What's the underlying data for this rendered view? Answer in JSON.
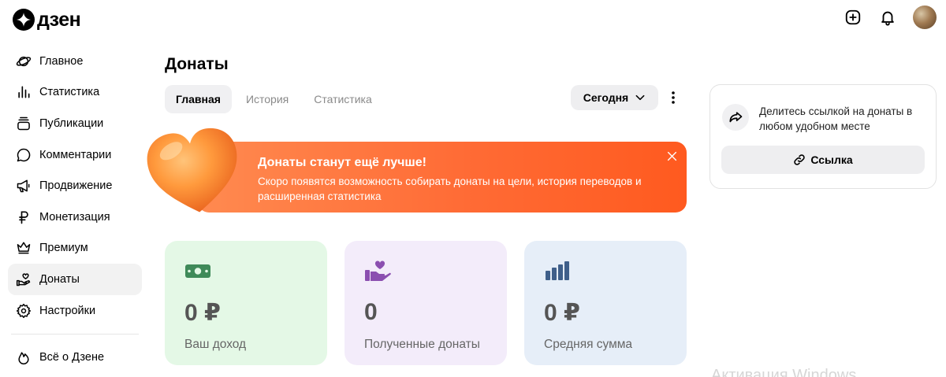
{
  "brand": {
    "name": "дзен",
    "logo_icon": "zen-star-icon"
  },
  "topbar": {
    "icons": [
      "add-icon",
      "bell-icon"
    ],
    "avatar": "avatar"
  },
  "sidebar": {
    "items": [
      {
        "label": "Главное",
        "icon": "planet-icon"
      },
      {
        "label": "Статистика",
        "icon": "bars-icon"
      },
      {
        "label": "Публикации",
        "icon": "stack-icon"
      },
      {
        "label": "Комментарии",
        "icon": "comment-icon"
      },
      {
        "label": "Продвижение",
        "icon": "megaphone-icon"
      },
      {
        "label": "Монетизация",
        "icon": "ruble-icon"
      },
      {
        "label": "Премиум",
        "icon": "crown-icon"
      },
      {
        "label": "Донаты",
        "icon": "hand-heart-icon",
        "active": true
      },
      {
        "label": "Настройки",
        "icon": "gear-icon"
      }
    ],
    "footer_item": {
      "label": "Всё о Дзене",
      "icon": "flame-icon"
    }
  },
  "main": {
    "title": "Донаты",
    "tabs": [
      {
        "label": "Главная",
        "active": true
      },
      {
        "label": "История"
      },
      {
        "label": "Статистика"
      }
    ],
    "period": {
      "label": "Сегодня"
    },
    "banner": {
      "title": "Донаты станут ещё лучше!",
      "text": "Скоро появятся возможность собирать донаты на цели, история переводов и расширенная статистика",
      "color": "#ff6b35"
    },
    "cards": [
      {
        "value": "0 ₽",
        "label": "Ваш доход",
        "icon": "money-icon",
        "color": "#e4f8e6"
      },
      {
        "value": "0",
        "label": "Полученные донаты",
        "icon": "donation-hand-icon",
        "color": "#f3ecfa"
      },
      {
        "value": "0 ₽",
        "label": "Средняя сумма",
        "icon": "bar-chart-icon",
        "color": "#e6eef8"
      }
    ]
  },
  "share_panel": {
    "text": "Делитесь ссылкой на донаты в любом удобном месте",
    "button_label": "Ссылка"
  },
  "watermark": "Активация Windows"
}
